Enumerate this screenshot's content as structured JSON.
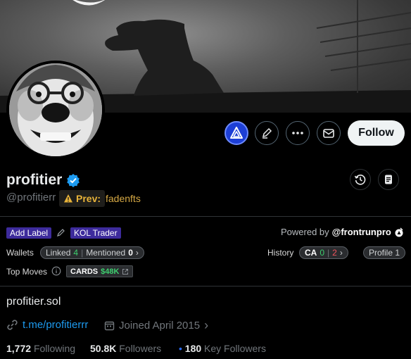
{
  "profile": {
    "display_name": "profitier",
    "handle": "@profitierr",
    "prev_label": "Prev:",
    "prev_name": "fadenfts",
    "bio": "profitier.sol",
    "website": "t.me/profitierrr",
    "joined": "Joined April 2015",
    "following_count": "1,772",
    "following_label": "Following",
    "followers_count": "50.8K",
    "followers_label": "Followers",
    "key_followers_count": "180",
    "key_followers_label": "Key Followers"
  },
  "actions": {
    "follow_label": "Follow"
  },
  "plugin": {
    "add_label": "Add Label",
    "kol_tag": "KOL Trader",
    "powered_by": "Powered by",
    "powered_brand": "@frontrunpro",
    "wallets_label": "Wallets",
    "linked_label": "Linked",
    "linked_count": "4",
    "mentioned_label": "Mentioned",
    "mentioned_count": "0",
    "history_label": "History",
    "ca_label": "CA",
    "ca_green": "0",
    "ca_red": "2",
    "profile_pill": "Profile 1",
    "top_moves_label": "Top Moves",
    "cards_label": "CARDS",
    "cards_value": "$48K"
  },
  "colors": {
    "accent_blue": "#1d9bf0",
    "green": "#3ecf6f",
    "red": "#f0545d",
    "purple_tag": "#3d2b9c",
    "warning_gold": "#e8b339"
  }
}
